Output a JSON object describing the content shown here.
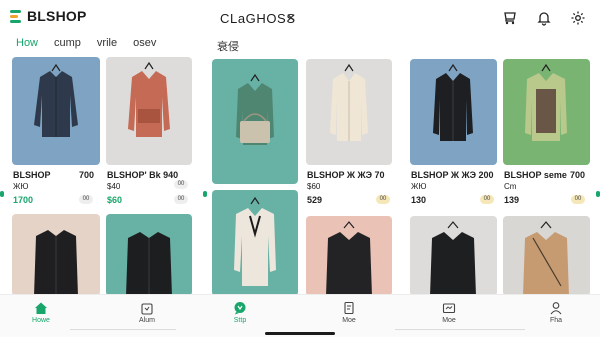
{
  "app": {
    "logo_text": "BLSHOP"
  },
  "search": {
    "title": "CLaGHOSS"
  },
  "category_tabs": [
    {
      "label": "How",
      "active": true
    },
    {
      "label": "cump",
      "active": false
    },
    {
      "label": "vrile",
      "active": false
    },
    {
      "label": "osev",
      "active": false
    }
  ],
  "section_label": "衰侵",
  "products": [
    {
      "name": "BLSHOP",
      "price": "700",
      "sub": "ЖЮ",
      "total": "1700",
      "badge": "00"
    },
    {
      "name": "BLSHOP' Bk 940",
      "price": "",
      "sub": "$60",
      "total": "$60",
      "badge": "00"
    },
    {
      "name": "",
      "price": "",
      "sub": "",
      "total": "",
      "badge": ""
    },
    {
      "name": "BLSHOP Ж ЖЭ 70",
      "price": "",
      "sub": "$60",
      "total": "529",
      "badge": "00"
    },
    {
      "name": "BLSHOP Ж ЖЭ 200",
      "price": "",
      "sub": "ЖЮ",
      "total": "130",
      "badge": "00"
    },
    {
      "name": "BLSHOP seme",
      "price": "700",
      "sub": "Cm",
      "total": "139",
      "badge": "00"
    }
  ],
  "bottom_nav": [
    {
      "label": "Howe",
      "icon": "home-icon",
      "active": true
    },
    {
      "label": "Alum",
      "icon": "bag-icon",
      "active": false
    },
    {
      "label": "Sttp",
      "icon": "chat-icon",
      "active": true
    },
    {
      "label": "Moe",
      "icon": "document-icon",
      "active": false
    },
    {
      "label": "Moe",
      "icon": "card-icon",
      "active": false
    },
    {
      "label": "Fha",
      "icon": "profile-icon",
      "active": false
    }
  ],
  "colors": {
    "accent": "#18a66b",
    "thumb_blue": "#7fa4c3",
    "thumb_gray": "#dedcdb",
    "thumb_teal": "#68b1a5",
    "thumb_green": "#79b473",
    "thumb_pink": "#ebc3b6"
  }
}
